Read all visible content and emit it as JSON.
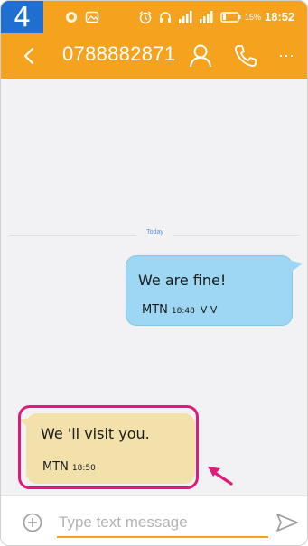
{
  "step_badge": "4",
  "statusbar": {
    "battery_percent": "15%",
    "time": "18:52"
  },
  "header": {
    "title": "0788882871"
  },
  "conversation": {
    "date_label": "Today",
    "messages": [
      {
        "direction": "outgoing",
        "text": "We are fine!",
        "sim": "MTN",
        "time": "18:48",
        "status": "V V"
      },
      {
        "direction": "incoming",
        "text": "We 'll visit you.",
        "sim": "MTN",
        "time": "18:50"
      }
    ]
  },
  "composer": {
    "placeholder": "Type text message"
  },
  "colors": {
    "accent": "#f5a21f",
    "outgoing_bubble": "#9dd7f3",
    "incoming_bubble": "#f3e1ab",
    "highlight": "#e0197a",
    "badge": "#1f6fd0"
  }
}
